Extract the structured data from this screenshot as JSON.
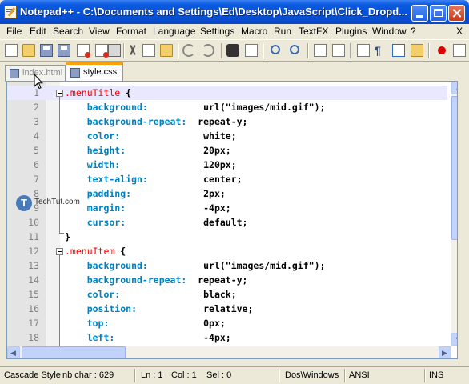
{
  "window": {
    "title": "Notepad++ - C:\\Documents and Settings\\Ed\\Desktop\\JavaScript\\Click_Dropd..."
  },
  "menu": {
    "items": [
      "File",
      "Edit",
      "Search",
      "View",
      "Format",
      "Language",
      "Settings",
      "Macro",
      "Run",
      "TextFX",
      "Plugins",
      "Window",
      "?"
    ],
    "close_glyph": "X"
  },
  "toolbar": {
    "icons": [
      "new-file-icon",
      "open-folder-icon",
      "save-icon",
      "save-all-icon",
      "close-icon",
      "close-all-icon",
      "print-icon",
      "cut-icon",
      "copy-icon",
      "paste-icon",
      "undo-icon",
      "redo-icon",
      "find-icon",
      "replace-icon",
      "zoom-in-icon",
      "zoom-out-icon",
      "sync-vertical-icon",
      "sync-horizontal-icon",
      "word-wrap-icon",
      "show-all-chars-icon",
      "indent-guide-icon",
      "user-lang-icon",
      "record-macro-icon"
    ]
  },
  "tabs": [
    {
      "label": "index.html",
      "active": false
    },
    {
      "label": "style.css",
      "active": true
    }
  ],
  "editor": {
    "current_line": 1,
    "lines": [
      {
        "n": "1",
        "parts": [
          {
            "t": ".menuTitle",
            "c": "sel-red"
          },
          {
            "t": " {",
            "c": "brace"
          }
        ]
      },
      {
        "n": "2",
        "parts": [
          {
            "t": "    background:          ",
            "c": "prop"
          },
          {
            "t": "url(\"images/mid.gif\");",
            "c": "val"
          }
        ]
      },
      {
        "n": "3",
        "parts": [
          {
            "t": "    background-repeat:  ",
            "c": "prop"
          },
          {
            "t": "repeat-y;",
            "c": "val"
          }
        ]
      },
      {
        "n": "4",
        "parts": [
          {
            "t": "    color:               ",
            "c": "prop"
          },
          {
            "t": "white;",
            "c": "val"
          }
        ]
      },
      {
        "n": "5",
        "parts": [
          {
            "t": "    height:              ",
            "c": "prop"
          },
          {
            "t": "20px;",
            "c": "val"
          }
        ]
      },
      {
        "n": "6",
        "parts": [
          {
            "t": "    width:               ",
            "c": "prop"
          },
          {
            "t": "120px;",
            "c": "val"
          }
        ]
      },
      {
        "n": "7",
        "parts": [
          {
            "t": "    text-align:          ",
            "c": "prop"
          },
          {
            "t": "center;",
            "c": "val"
          }
        ]
      },
      {
        "n": "8",
        "parts": [
          {
            "t": "    padding:             ",
            "c": "prop"
          },
          {
            "t": "2px;",
            "c": "val"
          }
        ]
      },
      {
        "n": "9",
        "parts": [
          {
            "t": "    margin:              ",
            "c": "prop"
          },
          {
            "t": "-4px;",
            "c": "val"
          }
        ]
      },
      {
        "n": "10",
        "parts": [
          {
            "t": "    cursor:              ",
            "c": "prop"
          },
          {
            "t": "default;",
            "c": "val"
          }
        ]
      },
      {
        "n": "11",
        "parts": [
          {
            "t": "}",
            "c": "brace"
          }
        ]
      },
      {
        "n": "12",
        "parts": [
          {
            "t": ".menuItem",
            "c": "sel-red"
          },
          {
            "t": " {",
            "c": "brace"
          }
        ]
      },
      {
        "n": "13",
        "parts": [
          {
            "t": "    background:          ",
            "c": "prop"
          },
          {
            "t": "url(\"images/mid.gif\");",
            "c": "val"
          }
        ]
      },
      {
        "n": "14",
        "parts": [
          {
            "t": "    background-repeat:  ",
            "c": "prop"
          },
          {
            "t": "repeat-y;",
            "c": "val"
          }
        ]
      },
      {
        "n": "15",
        "parts": [
          {
            "t": "    color:               ",
            "c": "prop"
          },
          {
            "t": "black;",
            "c": "val"
          }
        ]
      },
      {
        "n": "16",
        "parts": [
          {
            "t": "    position:            ",
            "c": "prop"
          },
          {
            "t": "relative;",
            "c": "val"
          }
        ]
      },
      {
        "n": "17",
        "parts": [
          {
            "t": "    top:                 ",
            "c": "prop"
          },
          {
            "t": "0px;",
            "c": "val"
          }
        ]
      },
      {
        "n": "18",
        "parts": [
          {
            "t": "    left:                ",
            "c": "prop"
          },
          {
            "t": "-4px;",
            "c": "val"
          }
        ]
      }
    ]
  },
  "watermark": {
    "logo_letter": "T",
    "text": "TechTut.com"
  },
  "statusbar": {
    "file_type": "Cascade Style",
    "nb_char": "nb char : 629",
    "line": "Ln : 1",
    "col": "Col : 1",
    "sel": "Sel : 0",
    "eol": "Dos\\Windows",
    "encoding": "ANSI",
    "mode": "INS"
  },
  "colors": {
    "selector": "#ff0000",
    "property": "#0080c0",
    "value": "#000000",
    "line_number": "#808080",
    "current_line_bg": "#e8e8ff",
    "active_tab_accent": "#f9a20b"
  }
}
